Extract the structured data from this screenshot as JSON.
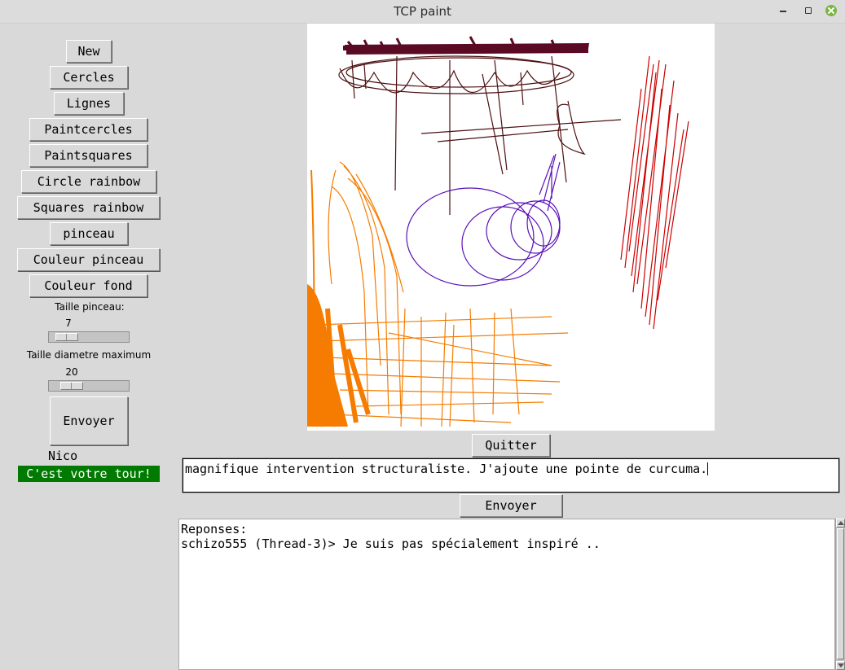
{
  "window": {
    "title": "TCP paint"
  },
  "tools": {
    "new": "New",
    "cercles": "Cercles",
    "lignes": "Lignes",
    "paintcercles": "Paintcercles",
    "paintsquares": "Paintsquares",
    "circle_rainbow": "Circle rainbow",
    "squares_rainbow": "Squares rainbow",
    "pinceau": "pinceau",
    "couleur_pinceau": "Couleur pinceau",
    "couleur_fond": "Couleur fond"
  },
  "brush_size": {
    "label": "Taille pinceau:",
    "value": "7"
  },
  "max_diameter": {
    "label": "Taille diametre maximum",
    "value": "20"
  },
  "send_drawing_label": "Envoyer",
  "user_name": "Nico",
  "turn_status": "C'est votre tour!",
  "turn_color": "#007a00",
  "quit_label": "Quitter",
  "chat": {
    "input_value": "magnifique intervention structuraliste. J'ajoute une pointe de curcuma.",
    "send_label": "Envoyer",
    "responses_header": "Reponses:",
    "messages": [
      "schizo555 (Thread-3)> Je suis pas spécialement inspiré .."
    ]
  },
  "drawing_colors": {
    "maroon": "#5a0a22",
    "brown": "#4d0f10",
    "red": "#cc0000",
    "purple": "#5a10b8",
    "orange": "#f57c00"
  }
}
